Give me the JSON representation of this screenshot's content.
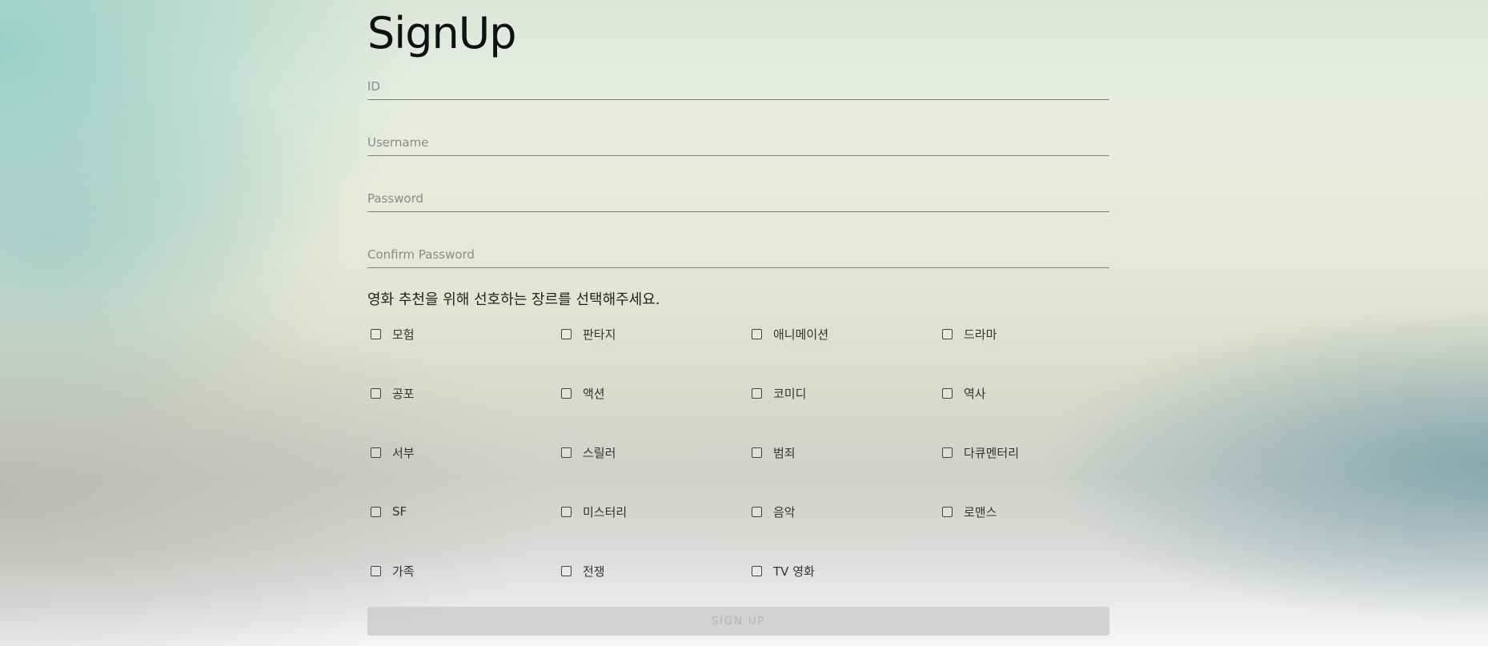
{
  "page": {
    "title": "SignUp"
  },
  "form": {
    "fields": [
      {
        "name": "id",
        "placeholder": "ID",
        "value": ""
      },
      {
        "name": "username",
        "placeholder": "Username",
        "value": ""
      },
      {
        "name": "password",
        "placeholder": "Password",
        "value": ""
      },
      {
        "name": "confirm-password",
        "placeholder": "Confirm Password",
        "value": ""
      }
    ],
    "genre_prompt": "영화 추천을 위해 선호하는 장르를 선택해주세요.",
    "genres": [
      {
        "label": "모험",
        "checked": false
      },
      {
        "label": "판타지",
        "checked": false
      },
      {
        "label": "애니메이션",
        "checked": false
      },
      {
        "label": "드라마",
        "checked": false
      },
      {
        "label": "공포",
        "checked": false
      },
      {
        "label": "액션",
        "checked": false
      },
      {
        "label": "코미디",
        "checked": false
      },
      {
        "label": "역사",
        "checked": false
      },
      {
        "label": "서부",
        "checked": false
      },
      {
        "label": "스릴러",
        "checked": false
      },
      {
        "label": "범죄",
        "checked": false
      },
      {
        "label": "다큐멘터리",
        "checked": false
      },
      {
        "label": "SF",
        "checked": false
      },
      {
        "label": "미스터리",
        "checked": false
      },
      {
        "label": "음악",
        "checked": false
      },
      {
        "label": "로맨스",
        "checked": false
      },
      {
        "label": "가족",
        "checked": false
      },
      {
        "label": "전쟁",
        "checked": false
      },
      {
        "label": "TV 영화",
        "checked": false
      }
    ],
    "submit_label": "SIGN UP"
  },
  "colors": {
    "text": "#111111",
    "underline": "#7d7f7a",
    "button_bg": "#c8c8c8",
    "button_text": "#b4b4b4"
  }
}
